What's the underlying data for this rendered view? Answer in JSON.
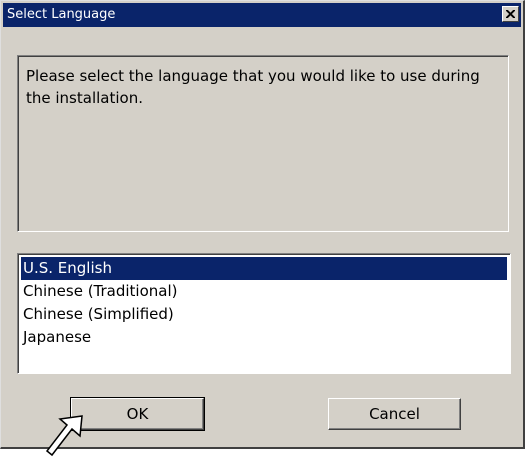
{
  "window": {
    "title": "Select Language",
    "close_icon": "close-icon"
  },
  "message": "Please select the language that you would like to use during the installation.",
  "languages": [
    {
      "label": "U.S. English",
      "selected": true
    },
    {
      "label": "Chinese (Traditional)",
      "selected": false
    },
    {
      "label": "Chinese (Simplified)",
      "selected": false
    },
    {
      "label": "Japanese",
      "selected": false
    }
  ],
  "buttons": {
    "ok_label": "OK",
    "cancel_label": "Cancel"
  },
  "colors": {
    "dialog_face": "#d4d0c8",
    "titlebar": "#0a246a",
    "selection": "#0a246a"
  },
  "cursor_icon": "arrow-cursor-icon"
}
